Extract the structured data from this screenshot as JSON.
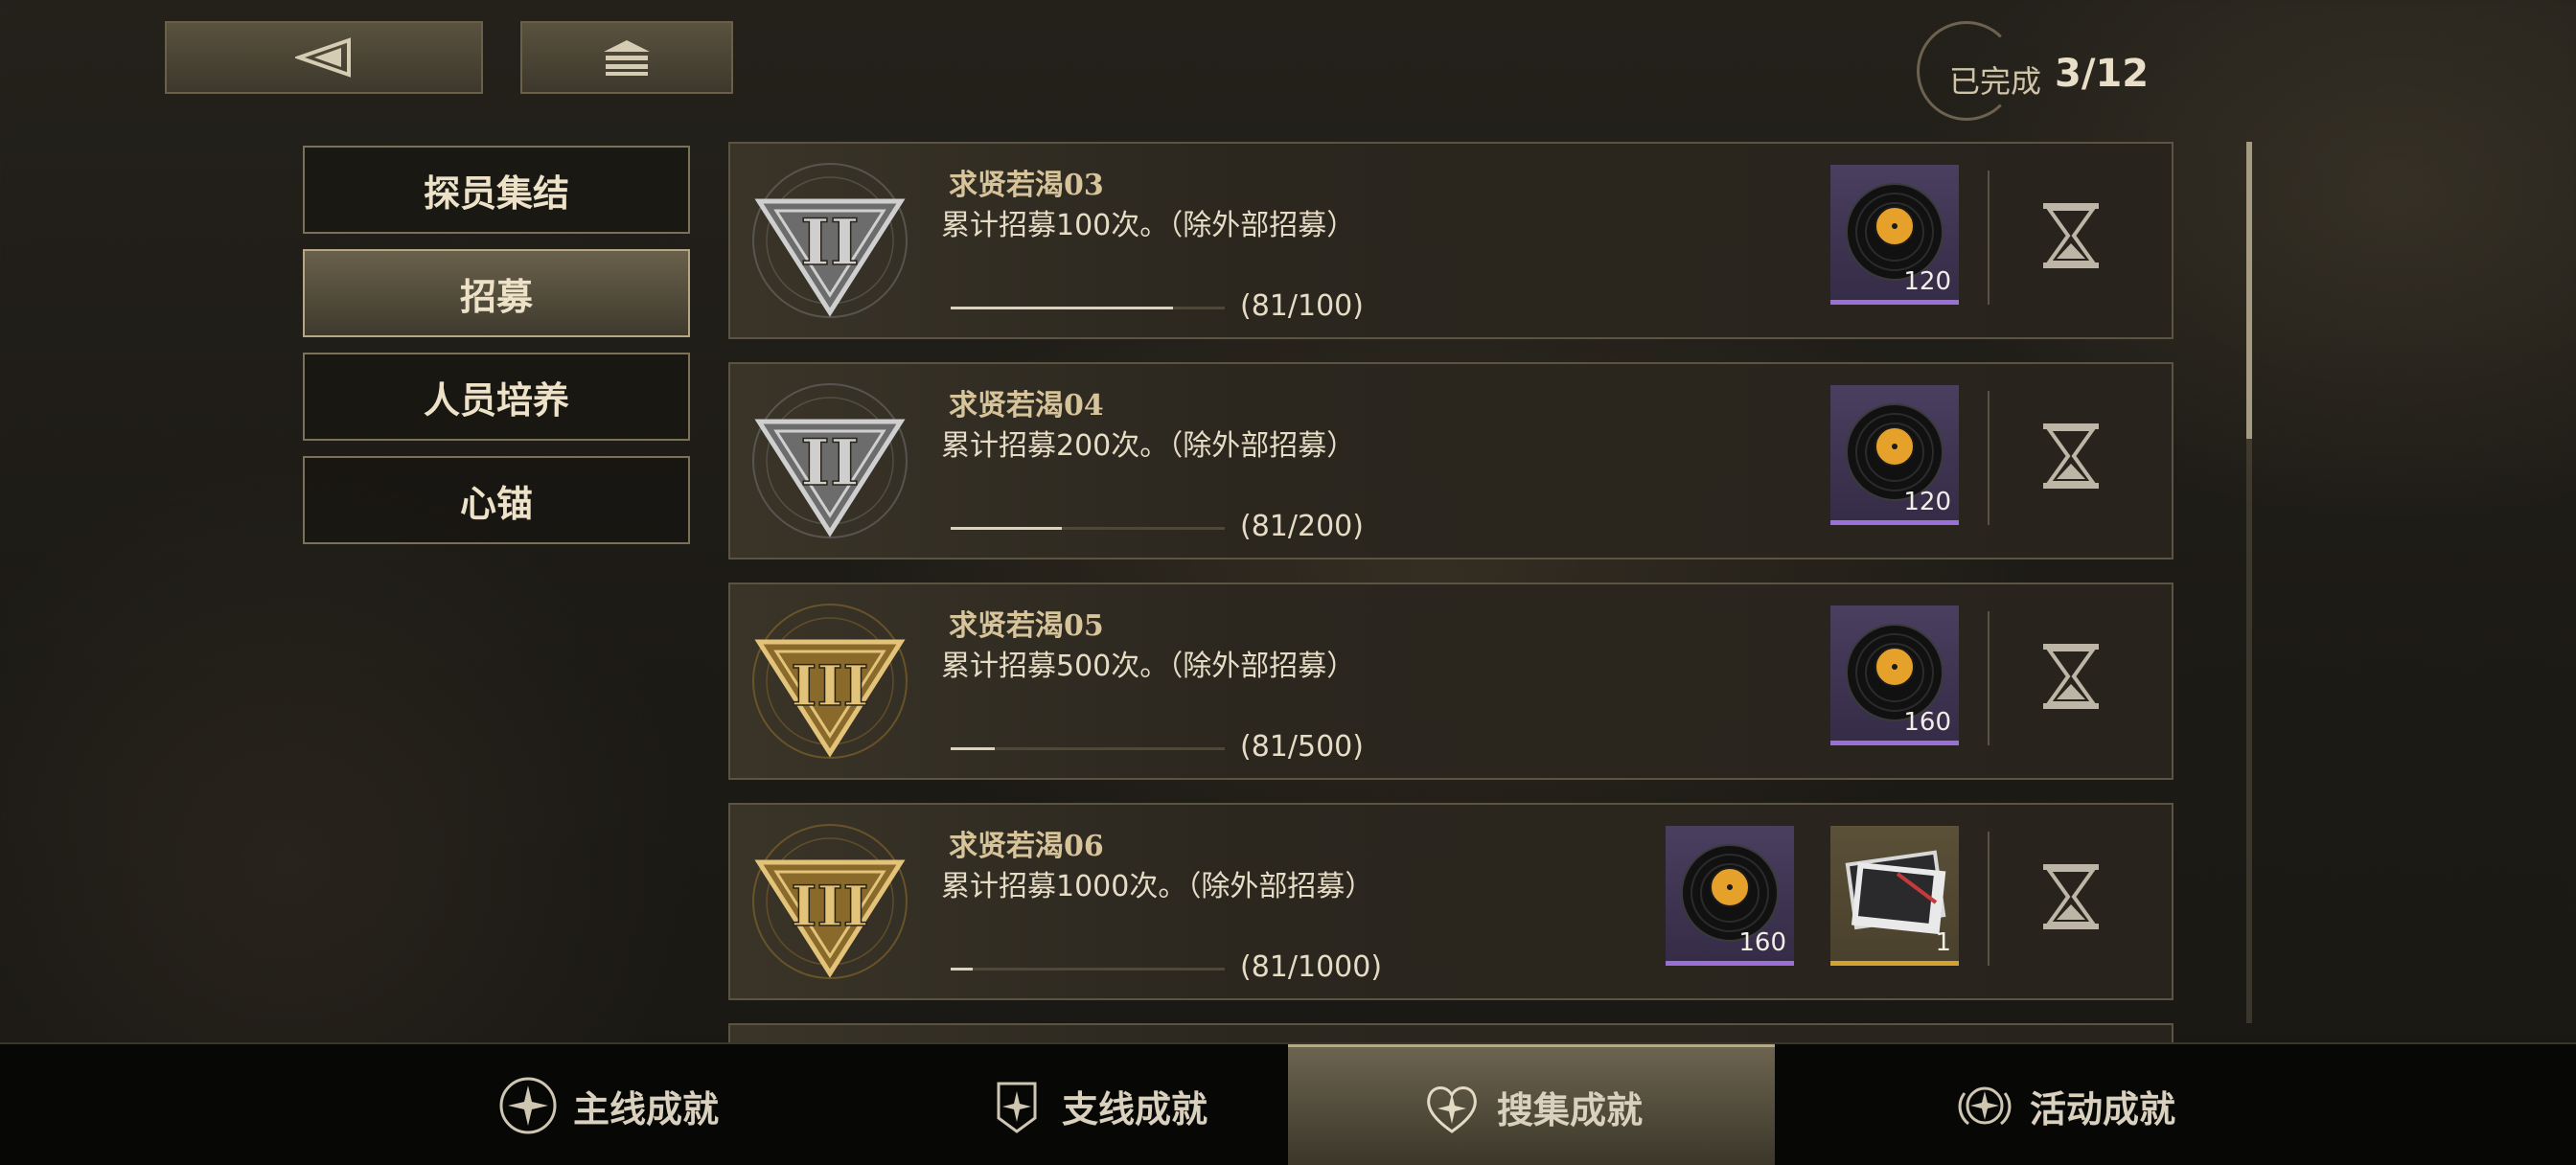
{
  "header": {
    "back_icon": "back-triangle-icon",
    "home_icon": "home-stack-icon",
    "completed_label": "已完成",
    "completed_value": "3/12"
  },
  "categories": [
    {
      "label": "探员集结",
      "active": false
    },
    {
      "label": "招募",
      "active": true
    },
    {
      "label": "人员培养",
      "active": false
    },
    {
      "label": "心锚",
      "active": false
    }
  ],
  "achievements": [
    {
      "title": "求贤若渴03",
      "desc": "累计招募100次。（除外部招募）",
      "progress_text": "(81/100)",
      "progress": 0.81,
      "badge": "II",
      "badge_tier": "silver",
      "rewards": [
        {
          "icon": "record-disc-icon",
          "qty": "120",
          "rarity": "purple"
        }
      ]
    },
    {
      "title": "求贤若渴04",
      "desc": "累计招募200次。（除外部招募）",
      "progress_text": "(81/200)",
      "progress": 0.405,
      "badge": "II",
      "badge_tier": "silver",
      "rewards": [
        {
          "icon": "record-disc-icon",
          "qty": "120",
          "rarity": "purple"
        }
      ]
    },
    {
      "title": "求贤若渴05",
      "desc": "累计招募500次。（除外部招募）",
      "progress_text": "(81/500)",
      "progress": 0.162,
      "badge": "III",
      "badge_tier": "gold",
      "rewards": [
        {
          "icon": "record-disc-icon",
          "qty": "160",
          "rarity": "purple"
        }
      ]
    },
    {
      "title": "求贤若渴06",
      "desc": "累计招募1000次。（除外部招募）",
      "progress_text": "(81/1000)",
      "progress": 0.081,
      "badge": "III",
      "badge_tier": "gold",
      "rewards": [
        {
          "icon": "record-disc-icon",
          "qty": "160",
          "rarity": "purple"
        },
        {
          "icon": "card-item-icon",
          "qty": "1",
          "rarity": "gold"
        }
      ]
    }
  ],
  "tabs": [
    {
      "label": "主线成就",
      "icon": "star-circle-icon",
      "active": false
    },
    {
      "label": "支线成就",
      "icon": "star-badge-icon",
      "active": false
    },
    {
      "label": "搜集成就",
      "icon": "star-heart-icon",
      "active": true
    },
    {
      "label": "活动成就",
      "icon": "star-wings-icon",
      "active": false
    }
  ],
  "colors": {
    "accent_gold": "#d8c49a",
    "purple_rarity": "#9b6fd8",
    "gold_rarity": "#d3a32e"
  }
}
